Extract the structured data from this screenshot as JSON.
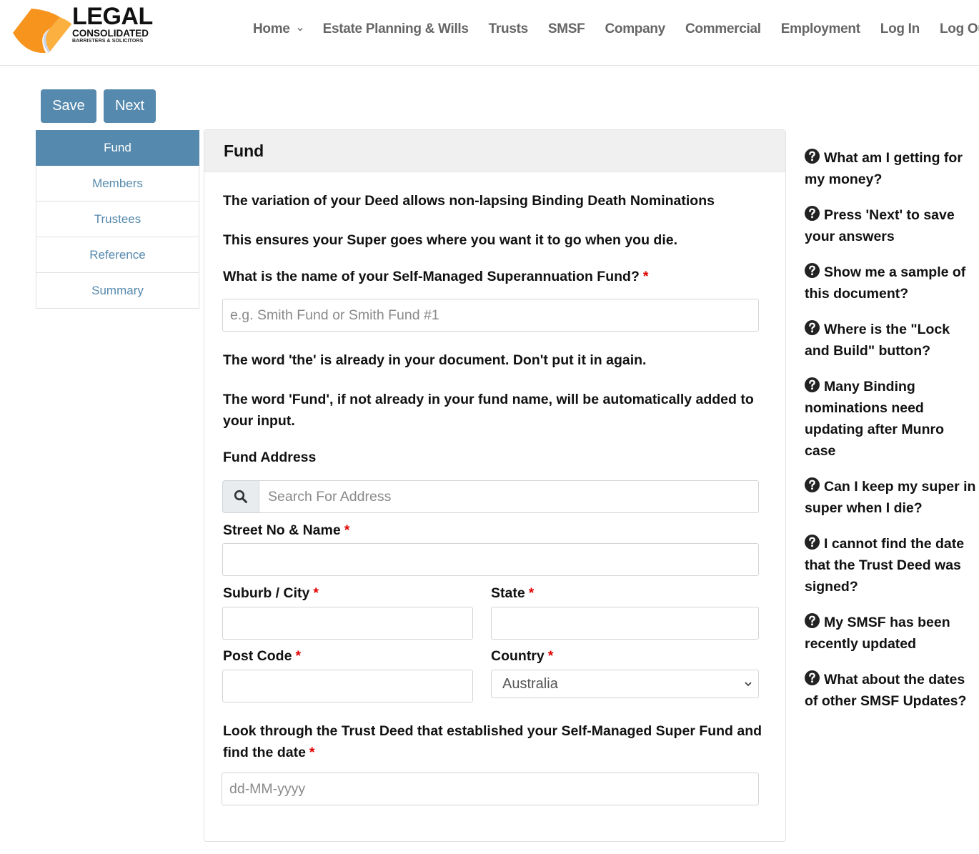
{
  "header": {
    "logo": {
      "title": "LEGAL",
      "subtitle": "CONSOLIDATED",
      "tagline": "BARRISTERS & SOLICITORS",
      "colors": {
        "primary": "#f7941d",
        "secondary": "#fbb040",
        "fold": "#c9d6ee"
      }
    },
    "nav": [
      {
        "label": "Home",
        "has_dropdown": true
      },
      {
        "label": "Estate Planning & Wills"
      },
      {
        "label": "Trusts"
      },
      {
        "label": "SMSF"
      },
      {
        "label": "Company"
      },
      {
        "label": "Commercial"
      },
      {
        "label": "Employment"
      },
      {
        "label": "Log In"
      },
      {
        "label": "Log Out"
      }
    ]
  },
  "toolbar": {
    "save_label": "Save",
    "next_label": "Next"
  },
  "steps": [
    {
      "label": "Fund",
      "active": true
    },
    {
      "label": "Members"
    },
    {
      "label": "Trustees"
    },
    {
      "label": "Reference"
    },
    {
      "label": "Summary"
    }
  ],
  "card": {
    "title": "Fund",
    "intro_1": "The variation of your Deed allows non-lapsing Binding Death Nominations",
    "intro_2": "This ensures your Super goes where you want it to go when you die.",
    "fund_name": {
      "label": "What is the name of your Self-Managed Superannuation Fund?",
      "required_mark": "*",
      "placeholder": "e.g. Smith Fund or Smith Fund #1",
      "value": ""
    },
    "note_1": "The word 'the' is already in your document. Don't put it in again.",
    "note_2": "The word 'Fund', if not already in your fund name, will be automatically added to your input.",
    "address": {
      "label": "Fund Address",
      "search_placeholder": "Search For Address",
      "search_icon": "search-icon",
      "street": {
        "label": "Street No & Name",
        "required_mark": "*",
        "value": ""
      },
      "suburb": {
        "label": "Suburb / City",
        "required_mark": "*",
        "value": ""
      },
      "state": {
        "label": "State",
        "required_mark": "*",
        "value": ""
      },
      "postcode": {
        "label": "Post Code",
        "required_mark": "*",
        "value": ""
      },
      "country": {
        "label": "Country",
        "required_mark": "*",
        "selected": "Australia"
      }
    },
    "deed_date": {
      "label": "Look through the Trust Deed that established your Self-Managed Super Fund and find the date",
      "required_mark": "*",
      "placeholder": "dd-MM-yyyy",
      "value": ""
    }
  },
  "help": {
    "icon": "question-circle-icon",
    "items": [
      "What am I getting for my money?",
      "Press 'Next' to save your answers",
      "Show me a sample of this document?",
      "Where is the \"Lock and Build\" button?",
      "Many Binding nominations need updating after Munro case",
      "Can I keep my super in super when I die?",
      "I cannot find the date that the Trust Deed was signed?",
      "My SMSF has been recently updated",
      "What about the dates of other SMSF Updates?"
    ]
  },
  "colors": {
    "accent": "#5589ad",
    "nav_text": "#666666",
    "required": "#e00000",
    "card_header_bg": "#f0f0f0"
  }
}
